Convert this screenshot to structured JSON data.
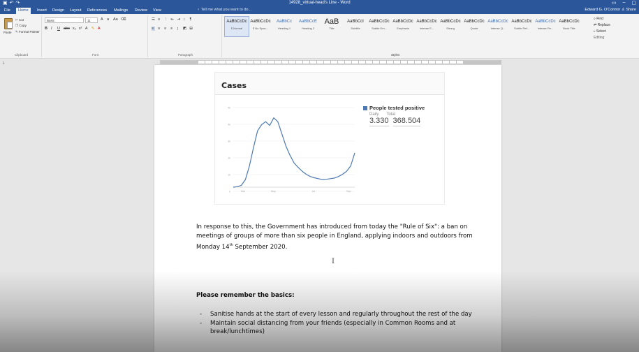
{
  "window": {
    "title": "14928_virtual-head's Line - Word",
    "user": "Edward G. O'Connor",
    "share": "Share"
  },
  "tabs": [
    "File",
    "Home",
    "Insert",
    "Design",
    "Layout",
    "References",
    "Mailings",
    "Review",
    "View"
  ],
  "tell_me": "Tell me what you want to do...",
  "ribbon": {
    "clipboard": {
      "paste": "Paste",
      "cut": "Cut",
      "copy": "Copy",
      "format_painter": "Format Painter",
      "label": "Clipboard"
    },
    "font": {
      "name": "Basic",
      "size": "11",
      "label": "Font"
    },
    "paragraph": {
      "label": "Paragraph"
    },
    "styles": {
      "label": "Styles",
      "items": [
        {
          "preview": "AaBbCcDc",
          "name": "¶ Normal"
        },
        {
          "preview": "AaBbCcDc",
          "name": "¶ No Spac..."
        },
        {
          "preview": "AaBbCc",
          "name": "Heading 1"
        },
        {
          "preview": "AaBbCcE",
          "name": "Heading 2"
        },
        {
          "preview": "AaB",
          "name": "Title"
        },
        {
          "preview": "AaBbCcI",
          "name": "Subtitle"
        },
        {
          "preview": "AaBbCcDc",
          "name": "Subtle Em..."
        },
        {
          "preview": "AaBbCcDc",
          "name": "Emphasis"
        },
        {
          "preview": "AaBbCcDc",
          "name": "Intense E..."
        },
        {
          "preview": "AaBbCcDc",
          "name": "Strong"
        },
        {
          "preview": "AaBbCcDc",
          "name": "Quote"
        },
        {
          "preview": "AaBbCcDc",
          "name": "Intense Q..."
        },
        {
          "preview": "AaBbCcDc",
          "name": "Subtle Ref..."
        },
        {
          "preview": "AaBbCcDc",
          "name": "Intense Re..."
        },
        {
          "preview": "AaBbCcDc",
          "name": "Book Title"
        }
      ]
    },
    "editing": {
      "find": "Find",
      "replace": "Replace",
      "select": "Select",
      "label": "Editing"
    }
  },
  "card": {
    "title": "Cases",
    "legend_name": "People tested positive",
    "daily_label": "Daily",
    "total_label": "Total",
    "daily_value": "3.330",
    "total_value": "368.504"
  },
  "chart_data": {
    "type": "line",
    "title": "Cases",
    "x_tick_labels": [
      "Mar",
      "May",
      "Jul",
      "Sep"
    ],
    "y_tick_labels": [
      "5k",
      "4k",
      "3k",
      "2k",
      "1k",
      "0"
    ],
    "series": [
      {
        "name": "People tested positive",
        "color": "#4e79b2",
        "values": [
          0,
          30,
          120,
          500,
          1400,
          2600,
          3700,
          4100,
          4300,
          4050,
          4550,
          4300,
          3500,
          2700,
          2100,
          1600,
          1300,
          1050,
          850,
          700,
          620,
          560,
          500,
          520,
          560,
          600,
          700,
          850,
          1050,
          1400,
          2250
        ]
      }
    ],
    "ylim": [
      0,
      5500
    ],
    "grid": true
  },
  "body": {
    "para_pre": "In response to this, the Government has introduced from today the \"Rule of Six\": a ban on meetings of groups of more than six people in England, applying indoors and outdoors from Monday 14",
    "para_sup": "th",
    "para_post": " September 2020.",
    "cursor": "I",
    "remember": "Please remember the basics:",
    "bullets": [
      "Sanitise hands at the start of every lesson and regularly throughout the rest of the day",
      "Maintain social distancing from your friends (especially in Common Rooms and at break/lunchtimes)"
    ]
  }
}
